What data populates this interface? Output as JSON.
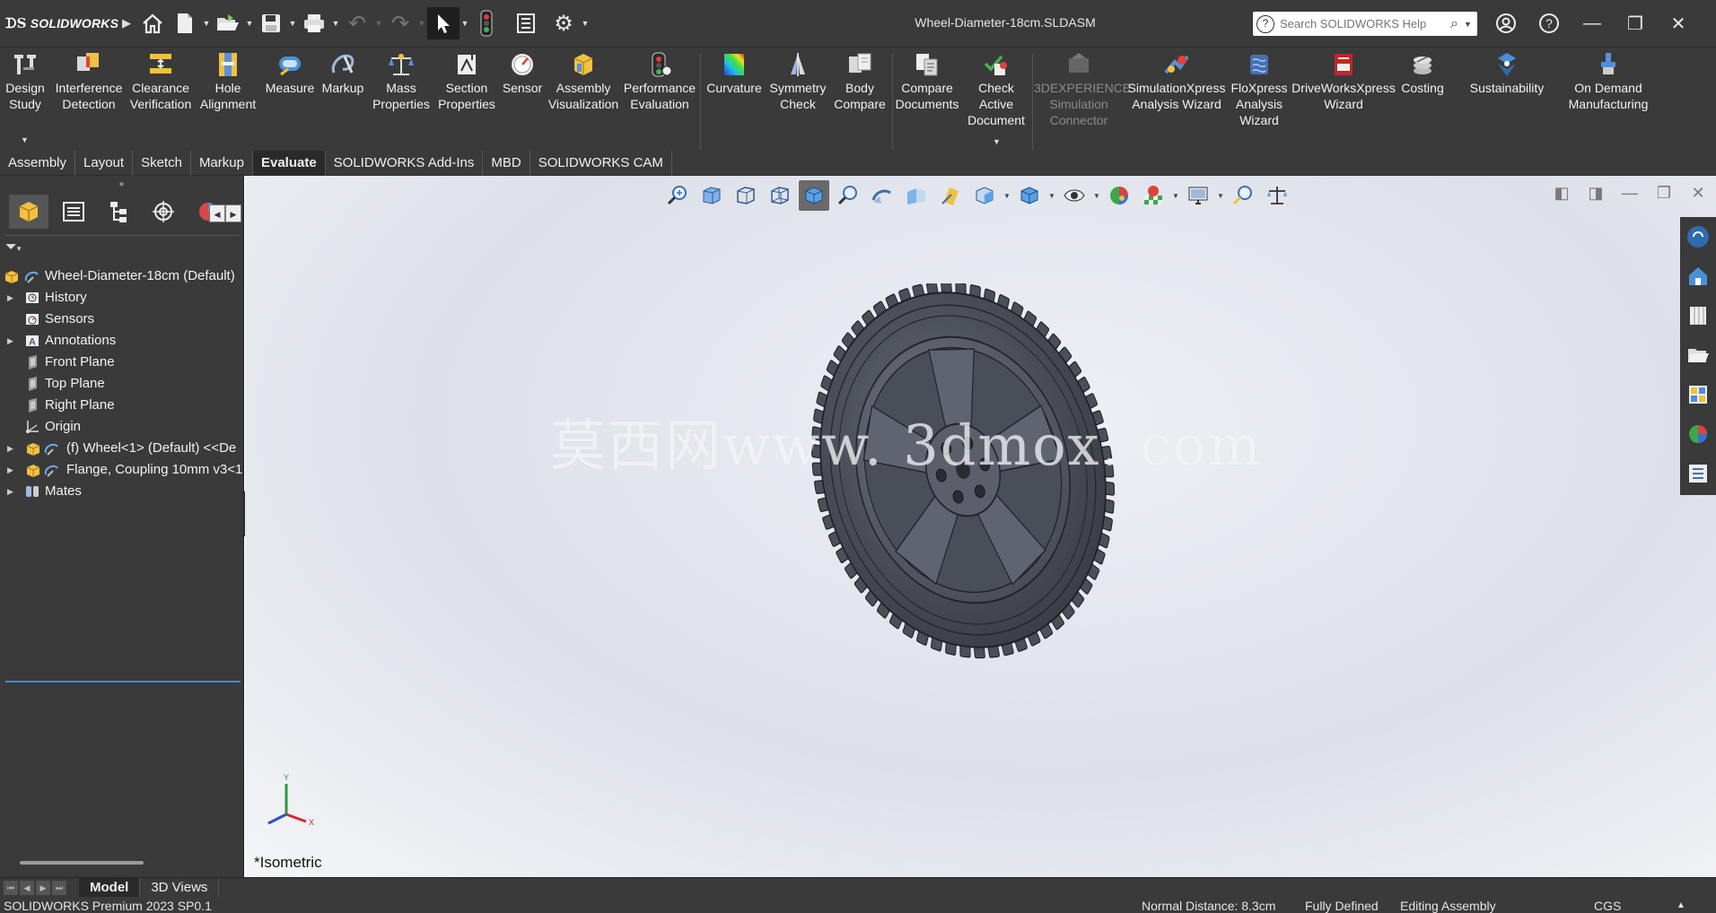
{
  "app": {
    "logo_text": "SOLIDWORKS",
    "document_title": "Wheel-Diameter-18cm.SLDASM"
  },
  "search": {
    "placeholder": "Search SOLIDWORKS Help"
  },
  "ribbon": {
    "buttons": [
      {
        "label_1": "Design",
        "label_2": "Study",
        "icon": "design-study-icon"
      },
      {
        "label_1": "Interference",
        "label_2": "Detection",
        "icon": "interference-detection-icon"
      },
      {
        "label_1": "Clearance",
        "label_2": "Verification",
        "icon": "clearance-verification-icon"
      },
      {
        "label_1": "Hole",
        "label_2": "Alignment",
        "icon": "hole-alignment-icon"
      },
      {
        "label_1": "Measure",
        "label_2": "",
        "icon": "measure-icon"
      },
      {
        "label_1": "Markup",
        "label_2": "",
        "icon": "markup-icon"
      },
      {
        "label_1": "Mass",
        "label_2": "Properties",
        "icon": "mass-properties-icon"
      },
      {
        "label_1": "Section",
        "label_2": "Properties",
        "icon": "section-properties-icon"
      },
      {
        "label_1": "Sensor",
        "label_2": "",
        "icon": "sensor-icon"
      },
      {
        "label_1": "Assembly",
        "label_2": "Visualization",
        "icon": "assembly-visualization-icon"
      },
      {
        "label_1": "Performance",
        "label_2": "Evaluation",
        "icon": "performance-evaluation-icon"
      },
      {
        "label_1": "Curvature",
        "label_2": "",
        "icon": "curvature-icon"
      },
      {
        "label_1": "Symmetry",
        "label_2": "Check",
        "icon": "symmetry-check-icon"
      },
      {
        "label_1": "Body",
        "label_2": "Compare",
        "icon": "body-compare-icon"
      },
      {
        "label_1": "Compare",
        "label_2": "Documents",
        "icon": "compare-documents-icon"
      },
      {
        "label_1": "Check",
        "label_2": "Active",
        "label_3": "Document",
        "icon": "check-active-document-icon"
      },
      {
        "label_1": "3DEXPERIENCE",
        "label_2": "Simulation",
        "label_3": "Connector",
        "icon": "3dexperience-simulation-connector-icon"
      },
      {
        "label_1": "SimulationXpress",
        "label_2": "Analysis Wizard",
        "icon": "simulationxpress-icon"
      },
      {
        "label_1": "FloXpress",
        "label_2": "Analysis",
        "label_3": "Wizard",
        "icon": "floxpress-icon"
      },
      {
        "label_1": "DriveWorksXpress",
        "label_2": "Wizard",
        "icon": "driveworksxpress-icon"
      },
      {
        "label_1": "Costing",
        "label_2": "",
        "icon": "costing-icon"
      },
      {
        "label_1": "Sustainability",
        "label_2": "",
        "icon": "sustainability-icon"
      },
      {
        "label_1": "On Demand",
        "label_2": "Manufacturing",
        "icon": "on-demand-manufacturing-icon"
      }
    ]
  },
  "command_tabs": [
    "Assembly",
    "Layout",
    "Sketch",
    "Markup",
    "Evaluate",
    "SOLIDWORKS Add-Ins",
    "MBD",
    "SOLIDWORKS CAM"
  ],
  "active_command_tab": "Evaluate",
  "feature_tree": {
    "root": "Wheel-Diameter-18cm  (Default)",
    "items": [
      {
        "label": "History",
        "expandable": true,
        "icon": "history-icon"
      },
      {
        "label": "Sensors",
        "expandable": false,
        "icon": "sensors-icon"
      },
      {
        "label": "Annotations",
        "expandable": true,
        "icon": "annotations-icon"
      },
      {
        "label": "Front Plane",
        "expandable": false,
        "icon": "plane-icon"
      },
      {
        "label": "Top Plane",
        "expandable": false,
        "icon": "plane-icon"
      },
      {
        "label": "Right Plane",
        "expandable": false,
        "icon": "plane-icon"
      },
      {
        "label": "Origin",
        "expandable": false,
        "icon": "origin-icon"
      },
      {
        "label": "(f) Wheel<1> (Default) <<De",
        "expandable": true,
        "icon": "part-icon"
      },
      {
        "label": "Flange, Coupling 10mm v3<1",
        "expandable": true,
        "icon": "part-icon"
      },
      {
        "label": "Mates",
        "expandable": true,
        "icon": "mates-icon"
      }
    ]
  },
  "watermark": "莫西网www. 3dmox. com",
  "view": {
    "orientation_label": "*Isometric"
  },
  "model_tabs": [
    "Model",
    "3D Views"
  ],
  "active_model_tab": "Model",
  "status_bar": {
    "product": "SOLIDWORKS Premium 2023 SP0.1",
    "normal_distance": "Normal Distance: 8.3cm",
    "definition": "Fully Defined",
    "mode": "Editing Assembly",
    "units": "CGS"
  },
  "colors": {
    "chrome": "#3a3a3a",
    "active_tab": "#2a2a2a",
    "accent_blue": "#3f8ad8",
    "wheel": "#50545f"
  }
}
